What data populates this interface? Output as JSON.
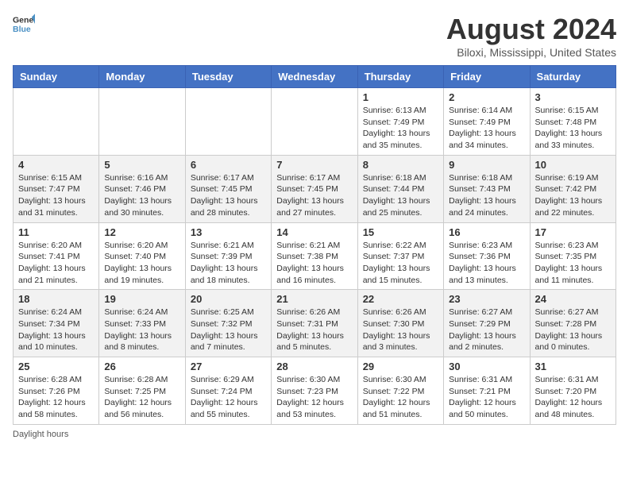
{
  "header": {
    "logo_line1": "General",
    "logo_line2": "Blue",
    "month_title": "August 2024",
    "subtitle": "Biloxi, Mississippi, United States"
  },
  "weekdays": [
    "Sunday",
    "Monday",
    "Tuesday",
    "Wednesday",
    "Thursday",
    "Friday",
    "Saturday"
  ],
  "weeks": [
    [
      {
        "day": "",
        "info": ""
      },
      {
        "day": "",
        "info": ""
      },
      {
        "day": "",
        "info": ""
      },
      {
        "day": "",
        "info": ""
      },
      {
        "day": "1",
        "info": "Sunrise: 6:13 AM\nSunset: 7:49 PM\nDaylight: 13 hours and 35 minutes."
      },
      {
        "day": "2",
        "info": "Sunrise: 6:14 AM\nSunset: 7:49 PM\nDaylight: 13 hours and 34 minutes."
      },
      {
        "day": "3",
        "info": "Sunrise: 6:15 AM\nSunset: 7:48 PM\nDaylight: 13 hours and 33 minutes."
      }
    ],
    [
      {
        "day": "4",
        "info": "Sunrise: 6:15 AM\nSunset: 7:47 PM\nDaylight: 13 hours and 31 minutes."
      },
      {
        "day": "5",
        "info": "Sunrise: 6:16 AM\nSunset: 7:46 PM\nDaylight: 13 hours and 30 minutes."
      },
      {
        "day": "6",
        "info": "Sunrise: 6:17 AM\nSunset: 7:45 PM\nDaylight: 13 hours and 28 minutes."
      },
      {
        "day": "7",
        "info": "Sunrise: 6:17 AM\nSunset: 7:45 PM\nDaylight: 13 hours and 27 minutes."
      },
      {
        "day": "8",
        "info": "Sunrise: 6:18 AM\nSunset: 7:44 PM\nDaylight: 13 hours and 25 minutes."
      },
      {
        "day": "9",
        "info": "Sunrise: 6:18 AM\nSunset: 7:43 PM\nDaylight: 13 hours and 24 minutes."
      },
      {
        "day": "10",
        "info": "Sunrise: 6:19 AM\nSunset: 7:42 PM\nDaylight: 13 hours and 22 minutes."
      }
    ],
    [
      {
        "day": "11",
        "info": "Sunrise: 6:20 AM\nSunset: 7:41 PM\nDaylight: 13 hours and 21 minutes."
      },
      {
        "day": "12",
        "info": "Sunrise: 6:20 AM\nSunset: 7:40 PM\nDaylight: 13 hours and 19 minutes."
      },
      {
        "day": "13",
        "info": "Sunrise: 6:21 AM\nSunset: 7:39 PM\nDaylight: 13 hours and 18 minutes."
      },
      {
        "day": "14",
        "info": "Sunrise: 6:21 AM\nSunset: 7:38 PM\nDaylight: 13 hours and 16 minutes."
      },
      {
        "day": "15",
        "info": "Sunrise: 6:22 AM\nSunset: 7:37 PM\nDaylight: 13 hours and 15 minutes."
      },
      {
        "day": "16",
        "info": "Sunrise: 6:23 AM\nSunset: 7:36 PM\nDaylight: 13 hours and 13 minutes."
      },
      {
        "day": "17",
        "info": "Sunrise: 6:23 AM\nSunset: 7:35 PM\nDaylight: 13 hours and 11 minutes."
      }
    ],
    [
      {
        "day": "18",
        "info": "Sunrise: 6:24 AM\nSunset: 7:34 PM\nDaylight: 13 hours and 10 minutes."
      },
      {
        "day": "19",
        "info": "Sunrise: 6:24 AM\nSunset: 7:33 PM\nDaylight: 13 hours and 8 minutes."
      },
      {
        "day": "20",
        "info": "Sunrise: 6:25 AM\nSunset: 7:32 PM\nDaylight: 13 hours and 7 minutes."
      },
      {
        "day": "21",
        "info": "Sunrise: 6:26 AM\nSunset: 7:31 PM\nDaylight: 13 hours and 5 minutes."
      },
      {
        "day": "22",
        "info": "Sunrise: 6:26 AM\nSunset: 7:30 PM\nDaylight: 13 hours and 3 minutes."
      },
      {
        "day": "23",
        "info": "Sunrise: 6:27 AM\nSunset: 7:29 PM\nDaylight: 13 hours and 2 minutes."
      },
      {
        "day": "24",
        "info": "Sunrise: 6:27 AM\nSunset: 7:28 PM\nDaylight: 13 hours and 0 minutes."
      }
    ],
    [
      {
        "day": "25",
        "info": "Sunrise: 6:28 AM\nSunset: 7:26 PM\nDaylight: 12 hours and 58 minutes."
      },
      {
        "day": "26",
        "info": "Sunrise: 6:28 AM\nSunset: 7:25 PM\nDaylight: 12 hours and 56 minutes."
      },
      {
        "day": "27",
        "info": "Sunrise: 6:29 AM\nSunset: 7:24 PM\nDaylight: 12 hours and 55 minutes."
      },
      {
        "day": "28",
        "info": "Sunrise: 6:30 AM\nSunset: 7:23 PM\nDaylight: 12 hours and 53 minutes."
      },
      {
        "day": "29",
        "info": "Sunrise: 6:30 AM\nSunset: 7:22 PM\nDaylight: 12 hours and 51 minutes."
      },
      {
        "day": "30",
        "info": "Sunrise: 6:31 AM\nSunset: 7:21 PM\nDaylight: 12 hours and 50 minutes."
      },
      {
        "day": "31",
        "info": "Sunrise: 6:31 AM\nSunset: 7:20 PM\nDaylight: 12 hours and 48 minutes."
      }
    ]
  ],
  "footer": {
    "daylight_label": "Daylight hours"
  }
}
